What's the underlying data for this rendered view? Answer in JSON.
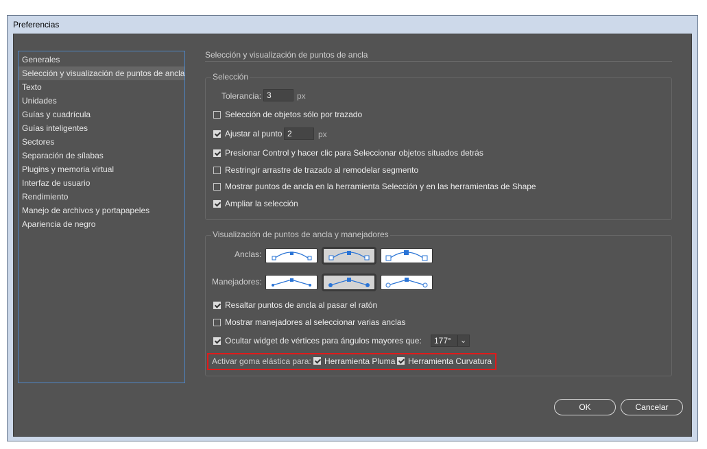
{
  "window": {
    "title": "Preferencias"
  },
  "sidebar": {
    "items": [
      {
        "label": "Generales"
      },
      {
        "label": "Selección y visualización de puntos de ancla"
      },
      {
        "label": "Texto"
      },
      {
        "label": "Unidades"
      },
      {
        "label": "Guías y cuadrícula"
      },
      {
        "label": "Guías inteligentes"
      },
      {
        "label": "Sectores"
      },
      {
        "label": "Separación de sílabas"
      },
      {
        "label": "Plugins y memoria virtual"
      },
      {
        "label": "Interfaz de usuario"
      },
      {
        "label": "Rendimiento"
      },
      {
        "label": "Manejo de archivos y portapapeles"
      },
      {
        "label": "Apariencia de negro"
      }
    ],
    "selected_index": 1
  },
  "main": {
    "section_title": "Selección y visualización de puntos de ancla",
    "seleccion": {
      "legend": "Selección",
      "tolerance_label": "Tolerancia:",
      "tolerance_value": "3",
      "tolerance_unit": "px",
      "options": [
        {
          "label": "Selección de objetos sólo por trazado",
          "checked": false
        },
        {
          "label": "Ajustar al punto",
          "checked": true,
          "value": "2",
          "unit": "px"
        },
        {
          "label": "Presionar Control y hacer clic para Seleccionar objetos situados detrás",
          "checked": true
        },
        {
          "label": "Restringir arrastre de trazado al remodelar segmento",
          "checked": false
        },
        {
          "label": "Mostrar puntos de ancla en la herramienta Selección y en las herramientas de Shape",
          "checked": false
        },
        {
          "label": "Ampliar la selección",
          "checked": true
        }
      ]
    },
    "visualizacion": {
      "legend": "Visualización de puntos de ancla y manejadores",
      "anclas_label": "Anclas:",
      "anclas_selected": 1,
      "manejadores_label": "Manejadores:",
      "manejadores_selected": 1,
      "options": [
        {
          "label": "Resaltar puntos de ancla al pasar el ratón",
          "checked": true
        },
        {
          "label": "Mostrar manejadores al seleccionar varias anclas",
          "checked": false
        },
        {
          "label": "Ocultar widget de vértices para ángulos mayores que:",
          "checked": true,
          "value": "177°"
        }
      ],
      "rubber_band": {
        "label": "Activar goma elástica para:",
        "pen": {
          "label": "Herramienta Pluma",
          "checked": true
        },
        "curvature": {
          "label": "Herramienta Curvatura",
          "checked": true
        }
      }
    }
  },
  "footer": {
    "ok_label": "OK",
    "cancel_label": "Cancelar"
  },
  "colors": {
    "accent": "#2a74d6",
    "highlight_box": "#e01a1a",
    "panel_bg": "#535353"
  }
}
